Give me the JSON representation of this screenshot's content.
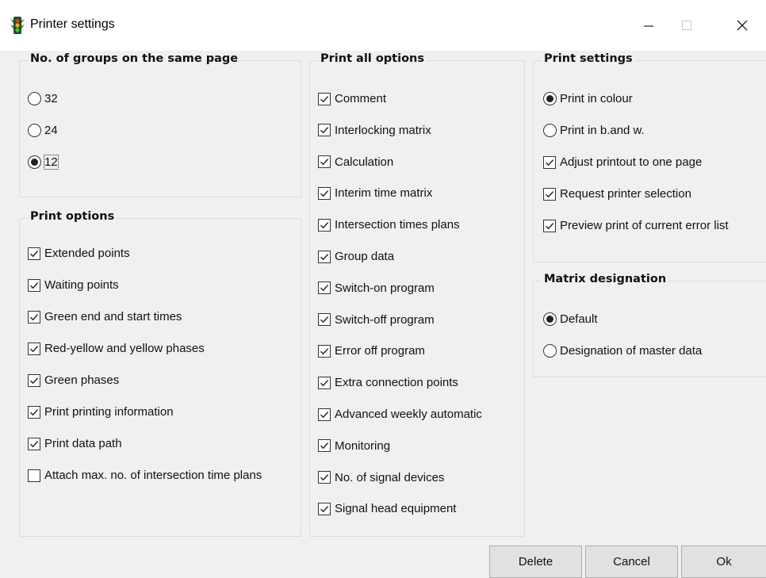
{
  "window": {
    "title": "Printer settings"
  },
  "groups_per_page": {
    "legend": "No. of groups on the same page",
    "options": [
      {
        "label": "32",
        "selected": false
      },
      {
        "label": "24",
        "selected": false
      },
      {
        "label": "12",
        "selected": true
      }
    ]
  },
  "print_options": {
    "legend": "Print options",
    "items": [
      {
        "label": "Extended points",
        "checked": true
      },
      {
        "label": "Waiting points",
        "checked": true
      },
      {
        "label": "Green end and start times",
        "checked": true
      },
      {
        "label": "Red-yellow and yellow phases",
        "checked": true
      },
      {
        "label": "Green phases",
        "checked": true
      },
      {
        "label": "Print printing information",
        "checked": true
      },
      {
        "label": "Print data path",
        "checked": true
      },
      {
        "label": "Attach max. no. of intersection time plans",
        "checked": false
      }
    ]
  },
  "print_all": {
    "legend": "Print all options",
    "items": [
      {
        "label": "Comment",
        "checked": true
      },
      {
        "label": "Interlocking matrix",
        "checked": true
      },
      {
        "label": "Calculation",
        "checked": true
      },
      {
        "label": "Interim time matrix",
        "checked": true
      },
      {
        "label": "Intersection times plans",
        "checked": true
      },
      {
        "label": "Group data",
        "checked": true
      },
      {
        "label": "Switch-on program",
        "checked": true
      },
      {
        "label": "Switch-off program",
        "checked": true
      },
      {
        "label": "Error off program",
        "checked": true
      },
      {
        "label": "Extra connection points",
        "checked": true
      },
      {
        "label": "Advanced weekly automatic",
        "checked": true
      },
      {
        "label": "Monitoring",
        "checked": true
      },
      {
        "label": "No. of signal devices",
        "checked": true
      },
      {
        "label": "Signal head equipment",
        "checked": true
      }
    ]
  },
  "print_settings": {
    "legend": "Print settings",
    "radios": [
      {
        "label": "Print in colour",
        "selected": true
      },
      {
        "label": "Print in b.and w.",
        "selected": false
      }
    ],
    "checks": [
      {
        "label": "Adjust printout to one page",
        "checked": true
      },
      {
        "label": "Request printer selection",
        "checked": true
      },
      {
        "label": "Preview print of current error list",
        "checked": true
      }
    ]
  },
  "matrix_designation": {
    "legend": "Matrix designation",
    "options": [
      {
        "label": "Default",
        "selected": true
      },
      {
        "label": "Designation of master data",
        "selected": false
      }
    ]
  },
  "buttons": {
    "delete": "Delete",
    "cancel": "Cancel",
    "ok": "Ok"
  }
}
